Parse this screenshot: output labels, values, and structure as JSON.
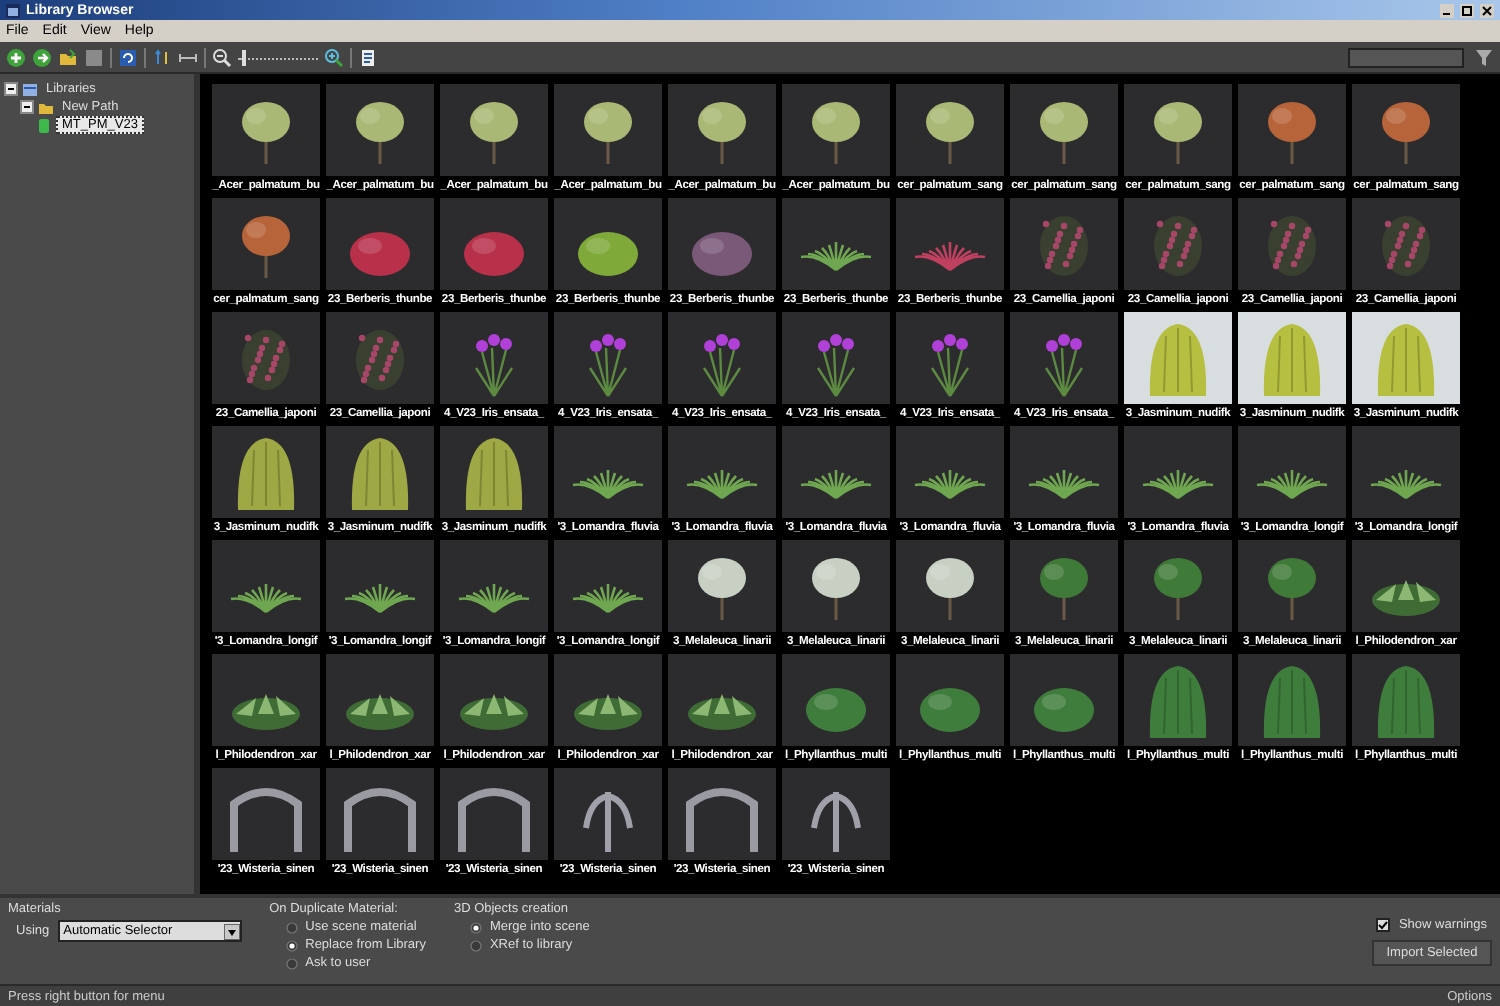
{
  "window": {
    "title": "Library Browser"
  },
  "menu": [
    "File",
    "Edit",
    "View",
    "Help"
  ],
  "toolbar": {
    "zoom_slider": {
      "level": 0.05
    }
  },
  "sidebar": {
    "tree": [
      {
        "label": "Libraries",
        "kind": "root",
        "expanded": true,
        "selected": false,
        "children": [
          {
            "label": "New Path",
            "kind": "folder",
            "expanded": true,
            "selected": false,
            "children": [
              {
                "label": "MT_PM_V23",
                "kind": "library",
                "selected": true
              }
            ]
          }
        ]
      }
    ]
  },
  "grid": {
    "items": [
      {
        "name": "_Acer_palmatum_bu",
        "kind": "tree"
      },
      {
        "name": "_Acer_palmatum_bu",
        "kind": "tree"
      },
      {
        "name": "_Acer_palmatum_bu",
        "kind": "tree"
      },
      {
        "name": "_Acer_palmatum_bu",
        "kind": "tree"
      },
      {
        "name": "_Acer_palmatum_bu",
        "kind": "tree"
      },
      {
        "name": "_Acer_palmatum_bu",
        "kind": "tree"
      },
      {
        "name": "cer_palmatum_sang",
        "kind": "tree"
      },
      {
        "name": "cer_palmatum_sang",
        "kind": "tree"
      },
      {
        "name": "cer_palmatum_sang",
        "kind": "tree"
      },
      {
        "name": "cer_palmatum_sang",
        "kind": "maple"
      },
      {
        "name": "cer_palmatum_sang",
        "kind": "maple"
      },
      {
        "name": "cer_palmatum_sang",
        "kind": "maple"
      },
      {
        "name": "23_Berberis_thunbe",
        "kind": "redbush"
      },
      {
        "name": "23_Berberis_thunbe",
        "kind": "redbush"
      },
      {
        "name": "23_Berberis_thunbe",
        "kind": "greenbush"
      },
      {
        "name": "23_Berberis_thunbe",
        "kind": "purplebush"
      },
      {
        "name": "23_Berberis_thunbe",
        "kind": "grass"
      },
      {
        "name": "23_Berberis_thunbe",
        "kind": "redgrass"
      },
      {
        "name": "23_Camellia_japoni",
        "kind": "camellia"
      },
      {
        "name": "23_Camellia_japoni",
        "kind": "camellia"
      },
      {
        "name": "23_Camellia_japoni",
        "kind": "camellia"
      },
      {
        "name": "23_Camellia_japoni",
        "kind": "camellia"
      },
      {
        "name": "23_Camellia_japoni",
        "kind": "camellia"
      },
      {
        "name": "23_Camellia_japoni",
        "kind": "camellia"
      },
      {
        "name": "4_V23_Iris_ensata_",
        "kind": "iris"
      },
      {
        "name": "4_V23_Iris_ensata_",
        "kind": "iris"
      },
      {
        "name": "4_V23_Iris_ensata_",
        "kind": "iris"
      },
      {
        "name": "4_V23_Iris_ensata_",
        "kind": "iris"
      },
      {
        "name": "4_V23_Iris_ensata_",
        "kind": "iris"
      },
      {
        "name": "4_V23_Iris_ensata_",
        "kind": "iris"
      },
      {
        "name": "3_Jasminum_nudifk",
        "kind": "studio"
      },
      {
        "name": "3_Jasminum_nudifk",
        "kind": "studio"
      },
      {
        "name": "3_Jasminum_nudifk",
        "kind": "studio"
      },
      {
        "name": "3_Jasminum_nudifk",
        "kind": "willow"
      },
      {
        "name": "3_Jasminum_nudifk",
        "kind": "willow"
      },
      {
        "name": "3_Jasminum_nudifk",
        "kind": "willow"
      },
      {
        "name": "'3_Lomandra_fluvia",
        "kind": "grass"
      },
      {
        "name": "'3_Lomandra_fluvia",
        "kind": "grass"
      },
      {
        "name": "'3_Lomandra_fluvia",
        "kind": "grass"
      },
      {
        "name": "'3_Lomandra_fluvia",
        "kind": "grass"
      },
      {
        "name": "'3_Lomandra_fluvia",
        "kind": "grass"
      },
      {
        "name": "'3_Lomandra_fluvia",
        "kind": "grass"
      },
      {
        "name": "'3_Lomandra_longif",
        "kind": "grass"
      },
      {
        "name": "'3_Lomandra_longif",
        "kind": "grass"
      },
      {
        "name": "'3_Lomandra_longif",
        "kind": "grass"
      },
      {
        "name": "'3_Lomandra_longif",
        "kind": "grass"
      },
      {
        "name": "'3_Lomandra_longif",
        "kind": "grass"
      },
      {
        "name": "'3_Lomandra_longif",
        "kind": "grass"
      },
      {
        "name": "3_Melaleuca_linarii",
        "kind": "melaleuca"
      },
      {
        "name": "3_Melaleuca_linarii",
        "kind": "melaleuca"
      },
      {
        "name": "3_Melaleuca_linarii",
        "kind": "melaleuca"
      },
      {
        "name": "3_Melaleuca_linarii",
        "kind": "greentree"
      },
      {
        "name": "3_Melaleuca_linarii",
        "kind": "greentree"
      },
      {
        "name": "3_Melaleuca_linarii",
        "kind": "greentree"
      },
      {
        "name": "l_Philodendron_xar",
        "kind": "philodendron"
      },
      {
        "name": "l_Philodendron_xar",
        "kind": "philodendron"
      },
      {
        "name": "l_Philodendron_xar",
        "kind": "philodendron"
      },
      {
        "name": "l_Philodendron_xar",
        "kind": "philodendron"
      },
      {
        "name": "l_Philodendron_xar",
        "kind": "philodendron"
      },
      {
        "name": "l_Philodendron_xar",
        "kind": "philodendron"
      },
      {
        "name": "l_Phyllanthus_multi",
        "kind": "phyllanthus"
      },
      {
        "name": "l_Phyllanthus_multi",
        "kind": "phyllanthus"
      },
      {
        "name": "l_Phyllanthus_multi",
        "kind": "phyllanthus"
      },
      {
        "name": "l_Phyllanthus_multi",
        "kind": "columnar"
      },
      {
        "name": "l_Phyllanthus_multi",
        "kind": "columnar"
      },
      {
        "name": "l_Phyllanthus_multi",
        "kind": "columnar"
      },
      {
        "name": "'23_Wisteria_sinen",
        "kind": "arch"
      },
      {
        "name": "'23_Wisteria_sinen",
        "kind": "arch"
      },
      {
        "name": "'23_Wisteria_sinen",
        "kind": "arch"
      },
      {
        "name": "'23_Wisteria_sinen",
        "kind": "hanging"
      },
      {
        "name": "'23_Wisteria_sinen",
        "kind": "arch"
      },
      {
        "name": "'23_Wisteria_sinen",
        "kind": "hanging"
      }
    ]
  },
  "options": {
    "materials": {
      "title": "Materials",
      "using_label": "Using",
      "using_value": "Automatic Selector"
    },
    "duplicate": {
      "title": "On Duplicate Material:",
      "options": [
        {
          "label": "Use scene material",
          "selected": false
        },
        {
          "label": "Replace from Library",
          "selected": true
        },
        {
          "label": "Ask to user",
          "selected": false
        }
      ]
    },
    "creation": {
      "title": "3D Objects creation",
      "options": [
        {
          "label": "Merge into scene",
          "selected": true
        },
        {
          "label": "XRef to library",
          "selected": false
        }
      ]
    },
    "show_warnings": {
      "label": "Show warnings",
      "checked": true
    },
    "import_button": "Import Selected"
  },
  "status_bar": {
    "message": "Press right button for menu",
    "options": "Options"
  }
}
